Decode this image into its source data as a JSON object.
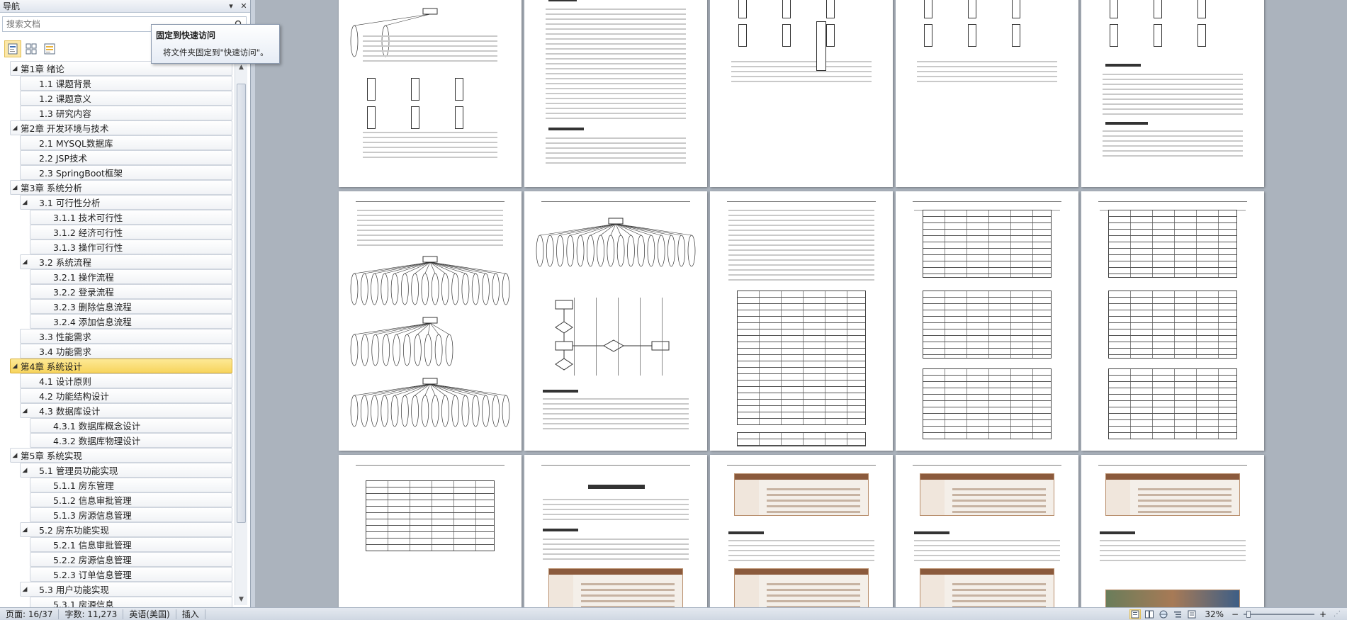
{
  "nav": {
    "title": "导航",
    "search_placeholder": "搜索文档",
    "tree": [
      {
        "label": "第1章 绪论",
        "level": 0,
        "expanded": true
      },
      {
        "label": "1.1 课题背景",
        "level": 1
      },
      {
        "label": "1.2 课题意义",
        "level": 1
      },
      {
        "label": "1.3 研究内容",
        "level": 1
      },
      {
        "label": "第2章 开发环境与技术",
        "level": 0,
        "expanded": true
      },
      {
        "label": "2.1 MYSQL数据库",
        "level": 1
      },
      {
        "label": "2.2 JSP技术",
        "level": 1
      },
      {
        "label": "2.3 SpringBoot框架",
        "level": 1
      },
      {
        "label": "第3章 系统分析",
        "level": 0,
        "expanded": true
      },
      {
        "label": "3.1 可行性分析",
        "level": 1,
        "expanded": true
      },
      {
        "label": "3.1.1 技术可行性",
        "level": 2
      },
      {
        "label": "3.1.2 经济可行性",
        "level": 2
      },
      {
        "label": "3.1.3 操作可行性",
        "level": 2
      },
      {
        "label": "3.2 系统流程",
        "level": 1,
        "expanded": true
      },
      {
        "label": "3.2.1 操作流程",
        "level": 2
      },
      {
        "label": "3.2.2 登录流程",
        "level": 2
      },
      {
        "label": "3.2.3 删除信息流程",
        "level": 2
      },
      {
        "label": "3.2.4 添加信息流程",
        "level": 2
      },
      {
        "label": "3.3 性能需求",
        "level": 1
      },
      {
        "label": "3.4 功能需求",
        "level": 1
      },
      {
        "label": "第4章 系统设计",
        "level": 0,
        "expanded": true,
        "selected": true
      },
      {
        "label": "4.1 设计原则",
        "level": 1
      },
      {
        "label": "4.2 功能结构设计",
        "level": 1
      },
      {
        "label": "4.3 数据库设计",
        "level": 1,
        "expanded": true
      },
      {
        "label": "4.3.1 数据库概念设计",
        "level": 2
      },
      {
        "label": "4.3.2 数据库物理设计",
        "level": 2
      },
      {
        "label": "第5章 系统实现",
        "level": 0,
        "expanded": true
      },
      {
        "label": "5.1 管理员功能实现",
        "level": 1,
        "expanded": true
      },
      {
        "label": "5.1.1 房东管理",
        "level": 2
      },
      {
        "label": "5.1.2 信息审批管理",
        "level": 2
      },
      {
        "label": "5.1.3 房源信息管理",
        "level": 2
      },
      {
        "label": "5.2 房东功能实现",
        "level": 1,
        "expanded": true
      },
      {
        "label": "5.2.1 信息审批管理",
        "level": 2
      },
      {
        "label": "5.2.2 房源信息管理",
        "level": 2
      },
      {
        "label": "5.2.3 订单信息管理",
        "level": 2
      },
      {
        "label": "5.3 用户功能实现",
        "level": 1,
        "expanded": true
      },
      {
        "label": "5.3.1 房源信息",
        "level": 2
      }
    ]
  },
  "tooltip": {
    "title": "固定到快速访问",
    "body": "将文件夹固定到\"快速访问\"。"
  },
  "status": {
    "page": "页面: 16/37",
    "words": "字数: 11,273",
    "language": "英语(美国)",
    "mode": "插入",
    "zoom": "32%",
    "zoom_level": 32
  },
  "colors": {
    "selected_fill": "#f7d45c",
    "doc_background": "#abb3bd",
    "screenshot_brown": "#8b5a3c"
  }
}
